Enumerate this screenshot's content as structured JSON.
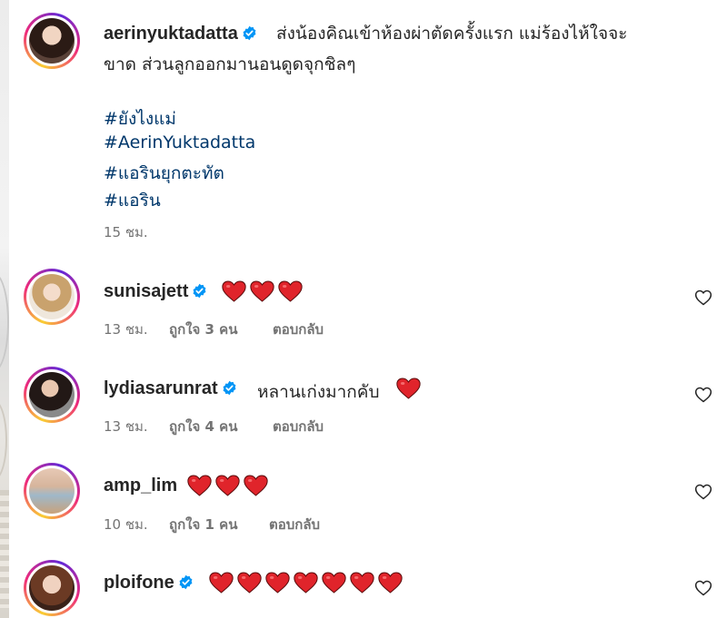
{
  "post": {
    "username": "aerinyuktadatta",
    "verified_icon": "verified-badge-icon",
    "caption_line1": "ส่งน้องคิณเข้าห้องผ่าตัดครั้งแรก แม่ร้องไห้ใจจะ",
    "caption_line2": "ขาด ส่วนลูกออกมานอนดูดจุกชิลๆ",
    "hashtags": [
      "#ยังไงแม่",
      "#AerinYuktadatta",
      "#แอรินยุกตะทัต",
      "#แอริน"
    ],
    "time": "15 ชม."
  },
  "comments": [
    {
      "username": "sunisajett",
      "verified": true,
      "text": "",
      "hearts": 3,
      "time": "13 ชม.",
      "likes": "ถูกใจ 3 คน",
      "reply": "ตอบกลับ"
    },
    {
      "username": "lydiasarunrat",
      "verified": true,
      "text": "หลานเก่งมากคับ",
      "hearts": 1,
      "time": "13 ชม.",
      "likes": "ถูกใจ 4 คน",
      "reply": "ตอบกลับ"
    },
    {
      "username": "amp_lim",
      "verified": false,
      "text": "",
      "hearts": 3,
      "time": "10 ชม.",
      "likes": "ถูกใจ 1 คน",
      "reply": "ตอบกลับ"
    },
    {
      "username": "ploifone",
      "verified": true,
      "text": "",
      "hearts": 7,
      "time": "",
      "likes": "",
      "reply": ""
    }
  ],
  "icons": {
    "heart_emoji": "red-heart-emoji-icon",
    "like": "heart-outline-icon",
    "verified": "verified-badge-icon"
  },
  "colors": {
    "verified_blue": "#0095f6",
    "heart_red": "#e0242b",
    "hashtag": "#00376b",
    "meta_gray": "#737373"
  }
}
